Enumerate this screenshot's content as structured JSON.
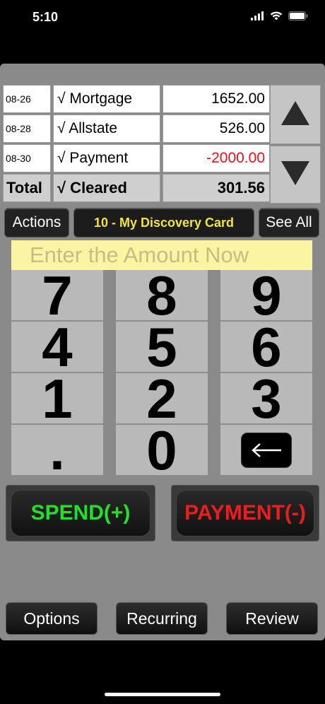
{
  "status": {
    "time": "5:10"
  },
  "register": {
    "rows": [
      {
        "date": "08-26",
        "description": "√ Mortgage",
        "amount": "1652.00",
        "negative": false
      },
      {
        "date": "08-28",
        "description": "√ Allstate",
        "amount": "526.00",
        "negative": false
      },
      {
        "date": "08-30",
        "description": "√ Payment",
        "amount": "-2000.00",
        "negative": true
      }
    ],
    "total": {
      "label": "Total",
      "status": "√ Cleared",
      "amount": "301.56"
    }
  },
  "toolbar": {
    "actions_label": "Actions",
    "account_label": "10 - My Discovery Card",
    "see_all_label": "See All"
  },
  "entry": {
    "placeholder": "Enter the Amount Now"
  },
  "keypad": {
    "keys": [
      "7",
      "8",
      "9",
      "4",
      "5",
      "6",
      "1",
      "2",
      "3",
      ".",
      "0"
    ]
  },
  "actions": {
    "spend_label": "SPEND(+)",
    "payment_label": "PAYMENT(-)"
  },
  "bottom": {
    "options_label": "Options",
    "recurring_label": "Recurring",
    "review_label": "Review"
  },
  "colors": {
    "spend": "#22e02a",
    "payment": "#ee1c1c",
    "negative_amount": "#e8101a",
    "account_text": "#f2e43a",
    "entry_background": "#fbf5a3"
  }
}
